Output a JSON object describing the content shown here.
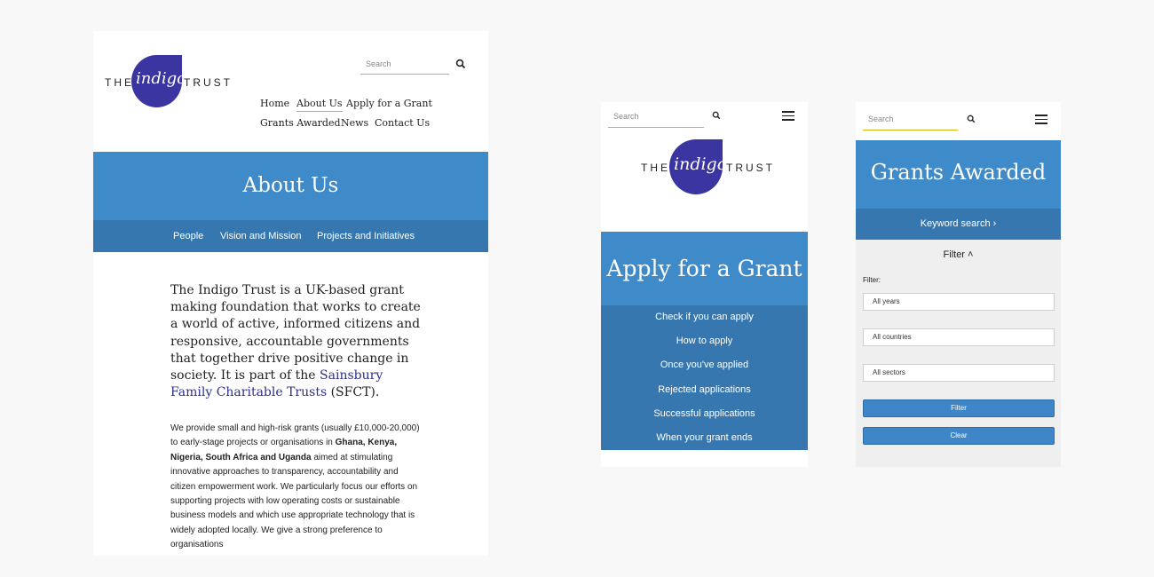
{
  "desktop": {
    "logo": {
      "the": "THE",
      "script": "indigo",
      "trust": "TRUST"
    },
    "search": {
      "placeholder": "Search"
    },
    "nav": [
      "Home",
      "About Us",
      "Apply for a Grant",
      "Grants Awarded",
      "News",
      "Contact Us"
    ],
    "hero_title": "About Us",
    "subnav": [
      "People",
      "Vision and Mission",
      "Projects and Initiatives"
    ],
    "intro": {
      "before": "The Indigo Trust is a UK-based grant making foundation that works to create a world of active, informed citizens and responsive, accountable governments that together drive positive change in society. It is part of the ",
      "link": "Sainsbury Family Charitable Trusts",
      "after": " (SFCT)."
    },
    "body": {
      "part1": "We provide small and high-risk grants (usually £10,000-20,000) to early-stage projects or organisations in ",
      "bold": "Ghana, Kenya, Nigeria, South Africa and Uganda",
      "part2": " aimed at stimulating innovative approaches to transparency, accountability and citizen empowerment work. We particularly focus our efforts on supporting projects with low operating costs or sustainable business models and which use appropriate technology that is widely adopted locally.  We give a strong preference to organisations"
    }
  },
  "mobile_apply": {
    "search": {
      "placeholder": "Search"
    },
    "logo": {
      "the": "THE",
      "script": "indigo",
      "trust": "TRUST"
    },
    "hero_title": "Apply for a Grant",
    "links": [
      "Check if you can apply",
      "How to apply",
      "Once you've applied",
      "Rejected applications",
      "Successful applications",
      "When your grant ends"
    ]
  },
  "mobile_grants": {
    "search": {
      "placeholder": "Search"
    },
    "hero_title": "Grants Awarded",
    "keyword_search": "Keyword search ›",
    "filter_toggle": "Filter ˄",
    "filter_label": "Filter:",
    "selects": [
      "All years",
      "All countries",
      "All sectors"
    ],
    "filter_button": "Filter",
    "clear_button": "Clear"
  },
  "colors": {
    "accent": "#e3b10f",
    "brand": "#3a35a0",
    "hero": "#3f8ac9",
    "subnav": "#3677b0"
  },
  "icons": [
    "search-icon",
    "menu-icon"
  ]
}
